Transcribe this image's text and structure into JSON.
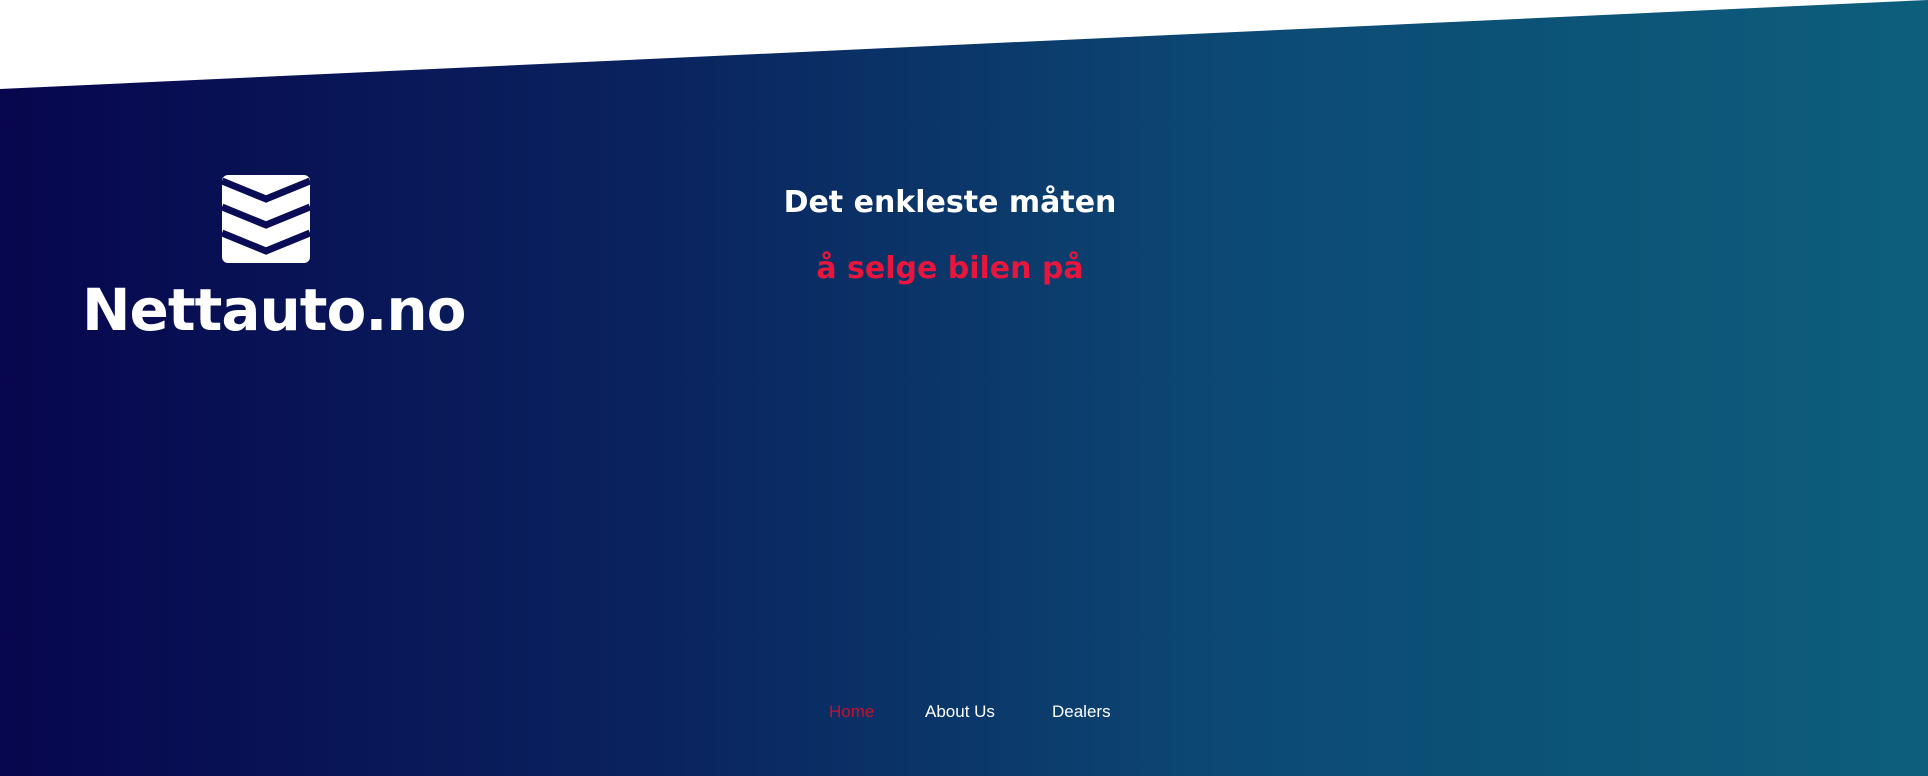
{
  "brand": {
    "name": "Nettauto.no",
    "logo_icon": "chevron-stripes-logo-icon"
  },
  "hero": {
    "headline": "Det enkleste måten",
    "subheadline": "å selge bilen på"
  },
  "nav": {
    "items": [
      {
        "label": "Home",
        "active": true
      },
      {
        "label": "About Us",
        "active": false
      },
      {
        "label": "Dealers",
        "active": false
      }
    ]
  },
  "colors": {
    "gradient_start": "#07064e",
    "gradient_end": "#0d5e7c",
    "accent": "#e8163c",
    "nav_active": "#c8102e",
    "text": "#ffffff"
  }
}
